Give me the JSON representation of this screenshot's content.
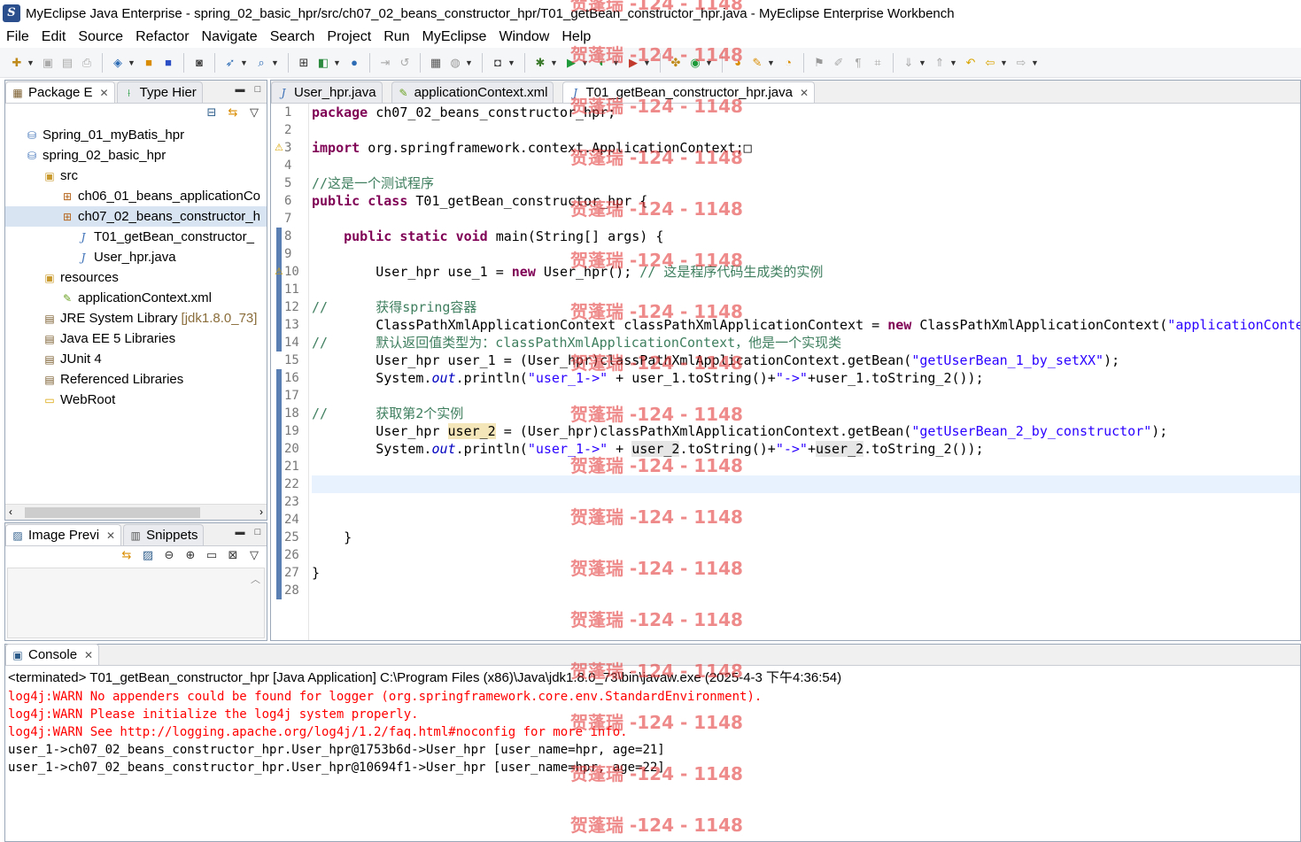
{
  "window": {
    "title": "MyEclipse Java Enterprise - spring_02_basic_hpr/src/ch07_02_beans_constructor_hpr/T01_getBean_constructor_hpr.java - MyEclipse Enterprise Workbench"
  },
  "menu": [
    "File",
    "Edit",
    "Source",
    "Refactor",
    "Navigate",
    "Search",
    "Project",
    "Run",
    "MyEclipse",
    "Window",
    "Help"
  ],
  "package_explorer": {
    "tabs": [
      {
        "label": "Package E",
        "icon": "package-explorer-icon",
        "active": true
      },
      {
        "label": "Type Hier",
        "icon": "type-hierarchy-icon",
        "active": false
      }
    ],
    "tree": [
      {
        "label": "Spring_01_myBatis_hpr",
        "icon": "project-icon",
        "indent": 1
      },
      {
        "label": "spring_02_basic_hpr",
        "icon": "project-icon",
        "indent": 1
      },
      {
        "label": "src",
        "icon": "source-folder-icon",
        "indent": 2
      },
      {
        "label": "ch06_01_beans_applicationCo",
        "icon": "package-icon",
        "indent": 3
      },
      {
        "label": "ch07_02_beans_constructor_h",
        "icon": "package-icon",
        "indent": 3,
        "selected": true
      },
      {
        "label": "T01_getBean_constructor_",
        "icon": "java-file-icon",
        "indent": 4
      },
      {
        "label": "User_hpr.java",
        "icon": "java-file-icon",
        "indent": 4
      },
      {
        "label": "resources",
        "icon": "source-folder-icon",
        "indent": 2
      },
      {
        "label": "applicationContext.xml",
        "icon": "xml-file-icon",
        "indent": 3
      },
      {
        "label": "JRE System Library",
        "suffix": "[jdk1.8.0_73]",
        "icon": "library-icon",
        "indent": 2
      },
      {
        "label": "Java EE 5 Libraries",
        "icon": "library-icon",
        "indent": 2
      },
      {
        "label": "JUnit 4",
        "icon": "library-icon",
        "indent": 2
      },
      {
        "label": "Referenced Libraries",
        "icon": "library-icon",
        "indent": 2
      },
      {
        "label": "WebRoot",
        "icon": "folder-icon",
        "indent": 2
      }
    ]
  },
  "image_preview": {
    "tabs": [
      {
        "label": "Image Previ",
        "icon": "image-preview-icon",
        "active": true
      },
      {
        "label": "Snippets",
        "icon": "snippets-icon",
        "active": false
      }
    ]
  },
  "editor": {
    "tabs": [
      {
        "label": "User_hpr.java",
        "icon": "java-file-icon",
        "active": false,
        "closable": false
      },
      {
        "label": "applicationContext.xml",
        "icon": "xml-file-icon",
        "active": false,
        "closable": false
      },
      {
        "label": "T01_getBean_constructor_hpr.java",
        "icon": "java-file-icon",
        "active": true,
        "closable": true
      }
    ],
    "current_line": 22,
    "lines": [
      [
        {
          "t": "package",
          "c": "kw"
        },
        {
          "t": " ch07_02_beans_constructor_hpr;"
        }
      ],
      [],
      [
        {
          "t": "import",
          "c": "kw"
        },
        {
          "t": " org.springframework.context.ApplicationContext;"
        },
        {
          "t": "□"
        }
      ],
      [],
      [
        {
          "t": "//这是一个测试程序",
          "c": "cm"
        }
      ],
      [
        {
          "t": "public",
          "c": "kw"
        },
        {
          "t": " "
        },
        {
          "t": "class",
          "c": "kw"
        },
        {
          "t": " T01_getBean_constructor_hpr {"
        }
      ],
      [],
      [
        {
          "t": "    "
        },
        {
          "t": "public",
          "c": "kw"
        },
        {
          "t": " "
        },
        {
          "t": "static",
          "c": "kw"
        },
        {
          "t": " "
        },
        {
          "t": "void",
          "c": "kw"
        },
        {
          "t": " main(String[] args) {"
        }
      ],
      [],
      [
        {
          "t": "        User_hpr use_1 = "
        },
        {
          "t": "new",
          "c": "kw"
        },
        {
          "t": " User_hpr(); "
        },
        {
          "t": "// 这是程序代码生成类的实例",
          "c": "cm"
        }
      ],
      [],
      [
        {
          "t": "//      获得spring容器",
          "c": "cm"
        }
      ],
      [
        {
          "t": "        ClassPathXmlApplicationContext classPathXmlApplicationContext = "
        },
        {
          "t": "new",
          "c": "kw"
        },
        {
          "t": " ClassPathXmlApplicationContext("
        },
        {
          "t": "\"applicationContext.xml\"",
          "c": "str"
        },
        {
          "t": ");"
        }
      ],
      [
        {
          "t": "//      默认返回值类型为：classPathXmlApplicationContext，他是一个实现类",
          "c": "cm"
        }
      ],
      [
        {
          "t": "        User_hpr user_1 = (User_hpr)classPathXmlApplicationContext.getBean("
        },
        {
          "t": "\"getUserBean_1_by_setXX\"",
          "c": "str"
        },
        {
          "t": ");"
        }
      ],
      [
        {
          "t": "        System."
        },
        {
          "t": "out",
          "c": "fld"
        },
        {
          "t": ".println("
        },
        {
          "t": "\"user_1->\"",
          "c": "str"
        },
        {
          "t": " + user_1.toString()+"
        },
        {
          "t": "\"->\"",
          "c": "str"
        },
        {
          "t": "+user_1.toString_2());"
        }
      ],
      [],
      [
        {
          "t": "//      获取第2个实例",
          "c": "cm"
        }
      ],
      [
        {
          "t": "        User_hpr "
        },
        {
          "t": "user_2",
          "c": "hl"
        },
        {
          "t": " = (User_hpr)classPathXmlApplicationContext.getBean("
        },
        {
          "t": "\"getUserBean_2_by_constructor\"",
          "c": "str"
        },
        {
          "t": ");"
        }
      ],
      [
        {
          "t": "        System."
        },
        {
          "t": "out",
          "c": "fld"
        },
        {
          "t": ".println("
        },
        {
          "t": "\"user_1->\"",
          "c": "str"
        },
        {
          "t": " + "
        },
        {
          "t": "user_2",
          "c": "occ"
        },
        {
          "t": ".toString()+"
        },
        {
          "t": "\"->\"",
          "c": "str"
        },
        {
          "t": "+"
        },
        {
          "t": "user_2",
          "c": "occ"
        },
        {
          "t": ".toString_2());"
        }
      ],
      [],
      [],
      [],
      [],
      [
        {
          "t": "    }"
        }
      ],
      [],
      [
        {
          "t": "}"
        }
      ],
      []
    ]
  },
  "console": {
    "tab_label": "Console",
    "header": "<terminated> T01_getBean_constructor_hpr [Java Application] C:\\Program Files (x86)\\Java\\jdk1.8.0_73\\bin\\javaw.exe (2025-4-3 下午4:36:54)",
    "lines": [
      {
        "text": "log4j:WARN No appenders could be found for logger (org.springframework.core.env.StandardEnvironment).",
        "error": true
      },
      {
        "text": "log4j:WARN Please initialize the log4j system properly.",
        "error": true
      },
      {
        "text": "log4j:WARN See http://logging.apache.org/log4j/1.2/faq.html#noconfig for more info.",
        "error": true
      },
      {
        "text": "user_1->ch07_02_beans_constructor_hpr.User_hpr@1753b6d->User_hpr [user_name=hpr, age=21]",
        "error": false
      },
      {
        "text": "user_1->ch07_02_beans_constructor_hpr.User_hpr@10694f1->User_hpr [user_name=hpr, age=22]",
        "error": false
      }
    ]
  },
  "watermark": "贺蓬瑞 -124 - 1148",
  "colors": {
    "keyword": "#7f0055",
    "string": "#2a00ff",
    "comment": "#3f7f5f",
    "error": "#ff0000",
    "watermark": "#e43c3c"
  }
}
